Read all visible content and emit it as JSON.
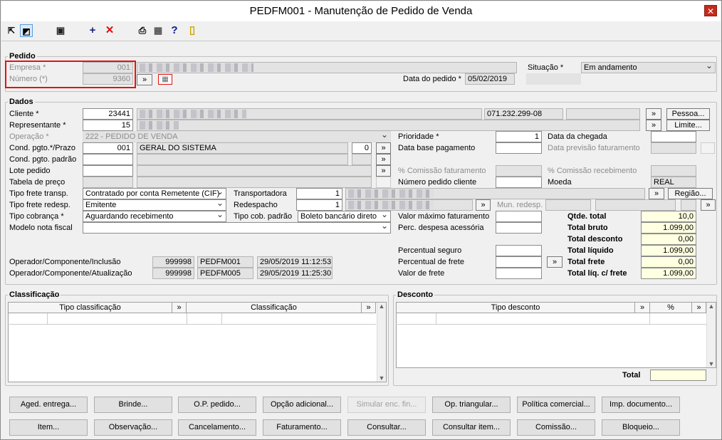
{
  "window": {
    "title": "PEDFM001 - Manutenção de Pedido de Venda",
    "close": "✕"
  },
  "toolbar": [
    "arrow-icon",
    "window-icon",
    "save-icon",
    "add-icon",
    "delete-icon",
    "print-icon",
    "calendar-icon",
    "help-icon",
    "exit-icon"
  ],
  "pedido": {
    "group": "Pedido",
    "empresa_label": "Empresa *",
    "empresa": "001",
    "numero_label": "Número (*)",
    "numero": "9360",
    "situacao_label": "Situação *",
    "situacao": "Em andamento",
    "data_label": "Data do pedido *",
    "data": "05/02/2019",
    "more": "»"
  },
  "dados": {
    "group": "Dados",
    "more": "»",
    "cliente_label": "Cliente *",
    "cliente": "23441",
    "cpf": "071.232.299-08",
    "pessoa": "Pessoa...",
    "representante_label": "Representante *",
    "representante": "15",
    "limite": "Limite...",
    "operacao_label": "Operação *",
    "operacao": "222 - PEDIDO DE VENDA",
    "cond_label": "Cond. pgto.*/Prazo",
    "cond": "001",
    "cond_desc": "GERAL DO SISTEMA",
    "prazo": "0",
    "cond_padrao_label": "Cond. pgto. padrão",
    "lote_label": "Lote pedido",
    "tabela_label": "Tabela de preço",
    "frete_transp_label": "Tipo frete transp.",
    "frete_transp": "Contratado por conta Remetente (CIF)",
    "frete_redesp_label": "Tipo frete redesp.",
    "frete_redesp": "Emitente",
    "cobranca_label": "Tipo cobrança *",
    "cobranca": "Aguardando recebimento",
    "modelo_label": "Modelo nota fiscal",
    "transportadora_label": "Transportadora",
    "transportadora": "1",
    "regiao": "Região...",
    "redespacho_label": "Redespacho",
    "redespacho": "1",
    "mun_redesp": "Mun. redesp.",
    "cob_padrao_label": "Tipo cob. padrão",
    "cob_padrao": "Boleto bancário direto",
    "prioridade_label": "Prioridade *",
    "prioridade": "1",
    "data_base_label": "Data base pagamento",
    "comissao_fat_label": "% Comissão faturamento",
    "num_pedido_cliente_label": "Número pedido cliente",
    "valor_max_label": "Valor máximo faturamento",
    "perc_desp_label": "Perc. despesa acessória",
    "perc_seguro_label": "Percentual seguro",
    "perc_frete_label": "Percentual de frete",
    "valor_frete_label": "Valor de frete",
    "data_chegada_label": "Data da chegada",
    "data_prev_label": "Data previsão faturamento",
    "comissao_rec_label": "% Comissão recebimento",
    "moeda_label": "Moeda",
    "moeda": "REAL",
    "totals": [
      {
        "label": "Qtde. total",
        "value": "10,0"
      },
      {
        "label": "Total bruto",
        "value": "1.099,00"
      },
      {
        "label": "Total desconto",
        "value": "0,00"
      },
      {
        "label": "Total líquido",
        "value": "1.099,00"
      },
      {
        "label": "Total frete",
        "value": "0,00"
      },
      {
        "label": "Total líq. c/ frete",
        "value": "1.099,00"
      }
    ],
    "inclusao_label": "Operador/Componente/Inclusão",
    "inclusao": [
      "999998",
      "PEDFM001",
      "29/05/2019 11:12:53"
    ],
    "atualizacao_label": "Operador/Componente/Atualização",
    "atualizacao": [
      "999998",
      "PEDFM005",
      "29/05/2019 11:25:30"
    ]
  },
  "classificacao": {
    "group": "Classificação",
    "col1": "Tipo classificação",
    "col2": "Classificação"
  },
  "desconto": {
    "group": "Desconto",
    "col1": "Tipo desconto",
    "col2": "%",
    "total_label": "Total"
  },
  "buttons_row1": [
    "Aged. entrega...",
    "Brinde...",
    "O.P. pedido...",
    "Opção adicional...",
    "Simular enc. fin...",
    "Op. triangular...",
    "Política comercial...",
    "Imp. documento..."
  ],
  "buttons_row2": [
    "Item...",
    "Observação...",
    "Cancelamento...",
    "Faturamento...",
    "Consultar...",
    "Consultar item...",
    "Comissão...",
    "Bloqueio..."
  ]
}
